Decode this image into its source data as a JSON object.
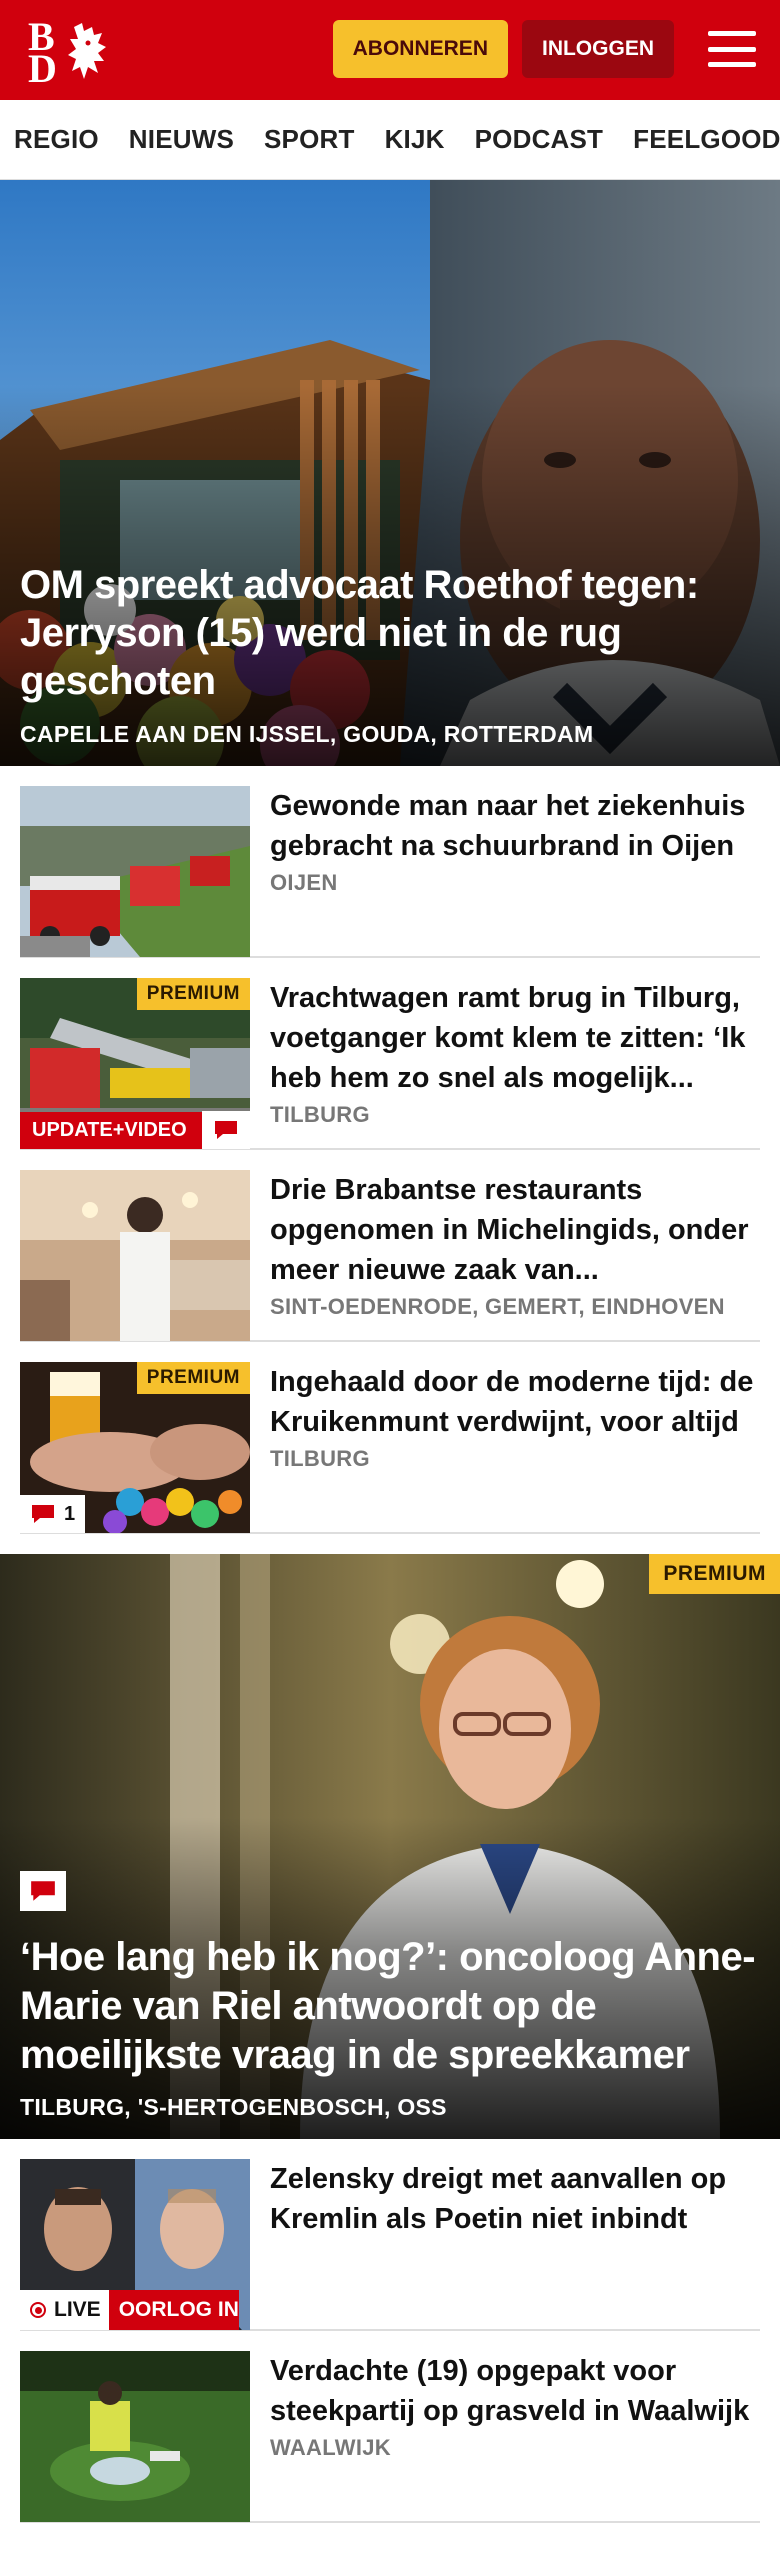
{
  "header": {
    "logo_text_top": "B",
    "logo_text_bottom": "D",
    "subscribe_label": "ABONNEREN",
    "login_label": "INLOGGEN",
    "brand_color": "#d0000d",
    "accent_color": "#f6c02c"
  },
  "nav": {
    "items": [
      "REGIO",
      "NIEUWS",
      "SPORT",
      "KIJK",
      "PODCAST",
      "FEELGOOD"
    ],
    "more_label": "I"
  },
  "hero": {
    "title": "OM spreekt advocaat Roethof tegen: Jerryson (15) werd niet in de rug geschoten",
    "location": "CAPELLE AAN DEN IJSSEL, GOUDA, ROTTERDAM"
  },
  "articles": [
    {
      "title": "Gewonde man naar het ziekenhuis gebracht na schuur­brand in Oijen",
      "location": "OIJEN"
    },
    {
      "title": "Vrachtwagen ramt brug in Tilburg, voetganger komt klem te zitten: ‘Ik heb hem zo snel als mogelijk...",
      "location": "TILBURG",
      "premium_label": "PREMIUM",
      "update_label": "UPDATE+VIDEO"
    },
    {
      "title": "Drie Brabantse restaurants opgenomen in Michelingids, onder meer nieuwe zaak van...",
      "location": "SINT-OEDENRODE, GEMERT, EINDHOVEN"
    },
    {
      "title": "Ingehaald door de moderne tijd: de Kruikenmunt verdwijnt, voor altijd",
      "location": "TILBURG",
      "premium_label": "PREMIUM",
      "comment_count": "1"
    }
  ],
  "feature": {
    "premium_label": "PREMIUM",
    "title": "‘Hoe lang heb ik nog?’: oncoloog Anne-Marie van Riel antwoordt op de moeilijkste vraag in de spreekkamer",
    "location": "TILBURG, 'S-HERTOGENBOSCH, OSS"
  },
  "articles2": [
    {
      "title": "Zelensky dreigt met aanvallen op Kremlin als Poetin niet inbindt",
      "live_label": "LIVE",
      "tag_label": "OORLOG IN OEKRAÏNE"
    },
    {
      "title": "Verdachte (19) opgepakt voor steekpartij op grasveld in Waalwijk",
      "location": "WAALWIJK"
    }
  ]
}
